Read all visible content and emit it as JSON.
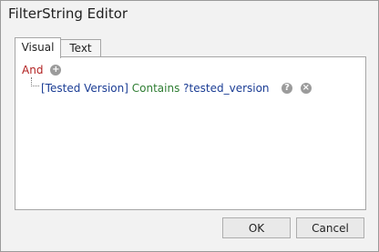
{
  "window": {
    "title": "FilterString Editor"
  },
  "tabs": [
    {
      "label": "Visual",
      "active": true
    },
    {
      "label": "Text",
      "active": false
    }
  ],
  "filter": {
    "group_operator": "And",
    "condition": {
      "field": "[Tested Version]",
      "operator": "Contains",
      "value": "?tested_version"
    }
  },
  "icons": {
    "add": "+",
    "help": "?",
    "remove": "×"
  },
  "buttons": {
    "ok": "OK",
    "cancel": "Cancel"
  },
  "colors": {
    "group_operator": "#b22222",
    "field": "#1a3c94",
    "condition_operator": "#2e7d32",
    "value": "#1a3c94"
  }
}
